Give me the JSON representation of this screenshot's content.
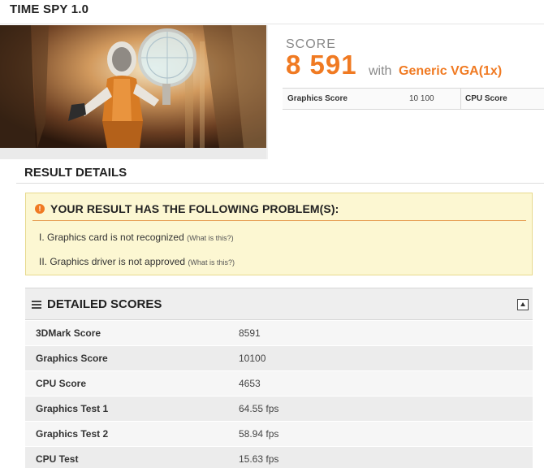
{
  "header": {
    "title": "TIME SPY 1.0"
  },
  "score": {
    "label": "SCORE",
    "value": "8 591",
    "with": "with",
    "gpu": "Generic VGA(1x)",
    "subscores": {
      "graphics_label": "Graphics Score",
      "graphics_value": "10 100",
      "cpu_label": "CPU Score"
    }
  },
  "result_details": {
    "title": "RESULT DETAILS",
    "problems": {
      "title": "YOUR RESULT HAS THE FOLLOWING PROBLEM(S):",
      "items": [
        {
          "text": "I. Graphics card is not recognized",
          "link": "(What is this?)"
        },
        {
          "text": "II. Graphics driver is not approved",
          "link": "(What is this?)"
        }
      ]
    }
  },
  "detailed_scores": {
    "title": "DETAILED SCORES",
    "rows": [
      {
        "label": "3DMark Score",
        "value": "8591"
      },
      {
        "label": "Graphics Score",
        "value": "10100"
      },
      {
        "label": "CPU Score",
        "value": "4653"
      },
      {
        "label": "Graphics Test 1",
        "value": "64.55 fps"
      },
      {
        "label": "Graphics Test 2",
        "value": "58.94 fps"
      },
      {
        "label": "CPU Test",
        "value": "15.63 fps"
      }
    ]
  },
  "icons": {
    "warning": "warning-icon",
    "menu": "menu-icon",
    "collapse": "collapse-icon"
  },
  "colors": {
    "accent": "#f07a22",
    "warning_bg": "#fcf7d2"
  }
}
